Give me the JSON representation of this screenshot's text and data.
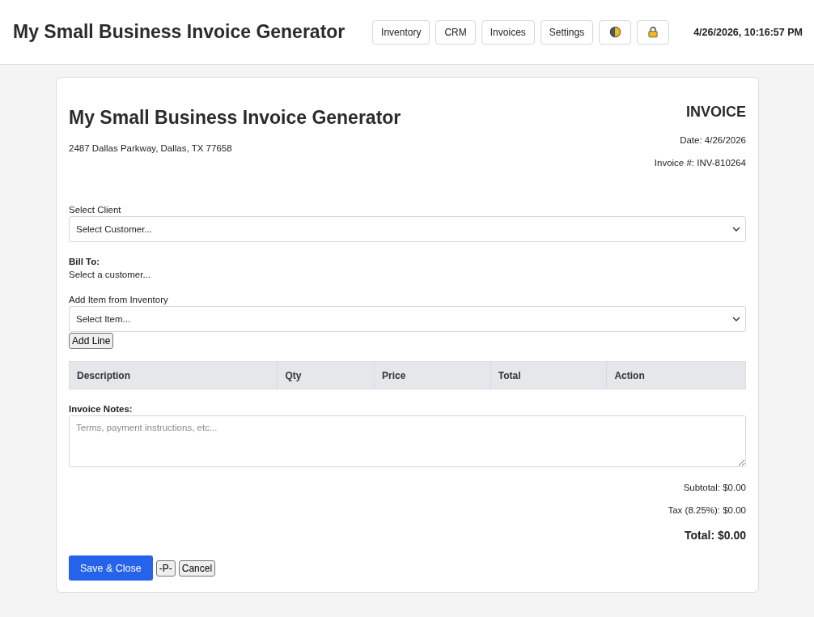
{
  "header": {
    "title": "My Small Business Invoice Generator",
    "nav": [
      {
        "kind": "text",
        "label": "Inventory"
      },
      {
        "kind": "text",
        "label": "CRM"
      },
      {
        "kind": "text",
        "label": "Invoices"
      },
      {
        "kind": "text",
        "label": "Settings"
      },
      {
        "kind": "theme"
      },
      {
        "kind": "lock"
      }
    ],
    "datetime": "4/26/2026, 10:16:57 PM"
  },
  "invoice": {
    "company_name": "My Small Business Invoice Generator",
    "address": "2487 Dallas Parkway, Dallas, TX 77658",
    "heading": "INVOICE",
    "date": "Date: 4/26/2026",
    "number": "Invoice #: INV-810264"
  },
  "client": {
    "label": "Select Client",
    "value": "Select Customer..."
  },
  "bill_to": {
    "label": "Bill To:",
    "text": "Select a customer..."
  },
  "item_picker": {
    "label": "Add Item from Inventory",
    "value": "Select Item...",
    "button": "Add Line"
  },
  "table": {
    "columns": [
      "Description",
      "Qty",
      "Price",
      "Total",
      "Action"
    ]
  },
  "notes": {
    "label": "Invoice Notes:",
    "placeholder": "Terms, payment instructions, etc..."
  },
  "totals": {
    "subtotal": "Subtotal: $0.00",
    "tax": "Tax (8.25%): $0.00",
    "total": "Total: $0.00"
  },
  "buttons": [
    {
      "kind": "primary",
      "label": "Save & Close"
    },
    {
      "kind": "plain",
      "label": "-P-"
    },
    {
      "kind": "plain",
      "label": "Cancel"
    }
  ]
}
